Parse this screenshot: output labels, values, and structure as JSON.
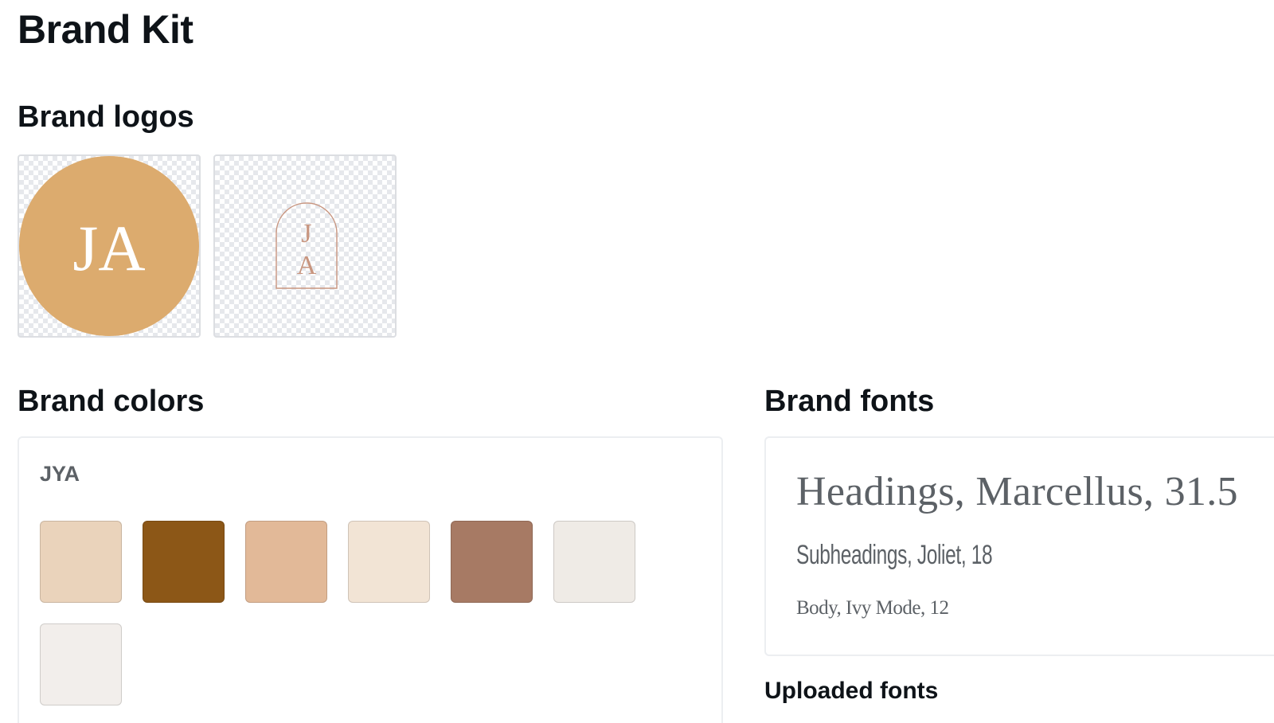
{
  "page": {
    "title": "Brand Kit"
  },
  "logos": {
    "title": "Brand logos",
    "items": [
      {
        "text": "JA",
        "circle_color": "#dcab6e",
        "text_color": "#ffffff",
        "icon": "ja-circle-logo"
      },
      {
        "letters": [
          "J",
          "A"
        ],
        "line_color": "#c8957f",
        "icon": "ja-arch-logo"
      }
    ]
  },
  "colors": {
    "title": "Brand colors",
    "palette_name": "JYA",
    "swatches": [
      "#ead3bb",
      "#8c5717",
      "#e2b998",
      "#f2e4d5",
      "#a77a64",
      "#efebe6",
      "#f2eeeb"
    ]
  },
  "fonts": {
    "title": "Brand fonts",
    "heading": "Headings, Marcellus, 31.5",
    "subheading": "Subheadings, Joliet, 18",
    "body": "Body, Ivy Mode, 12",
    "uploaded_title": "Uploaded fonts"
  }
}
